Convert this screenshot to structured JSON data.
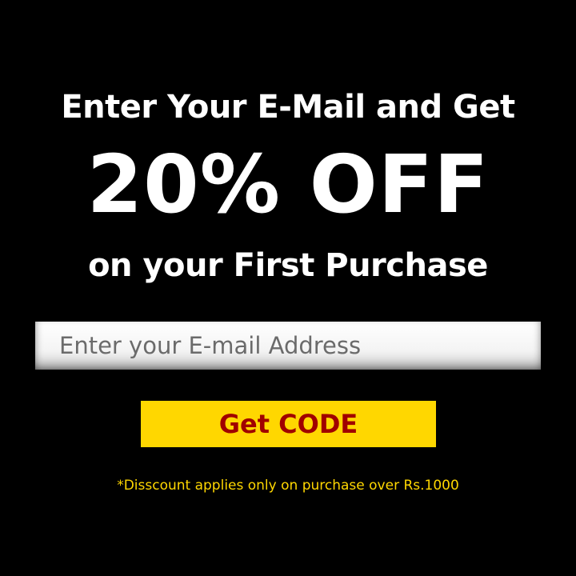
{
  "promo": {
    "headline": "Enter Your E-Mail and Get",
    "offer": "20% OFF",
    "subline": "on your First Purchase"
  },
  "form": {
    "email_placeholder": "Enter your E-mail Address",
    "email_value": "",
    "button_label": "Get CODE"
  },
  "disclaimer": "*Disscount applies only on purchase over Rs.1000",
  "colors": {
    "background": "#000000",
    "headline_text": "#ffffff",
    "button_bg": "#ffd700",
    "button_text": "#a00000",
    "disclaimer_text": "#ffd700",
    "input_placeholder": "#6b6b6b"
  }
}
